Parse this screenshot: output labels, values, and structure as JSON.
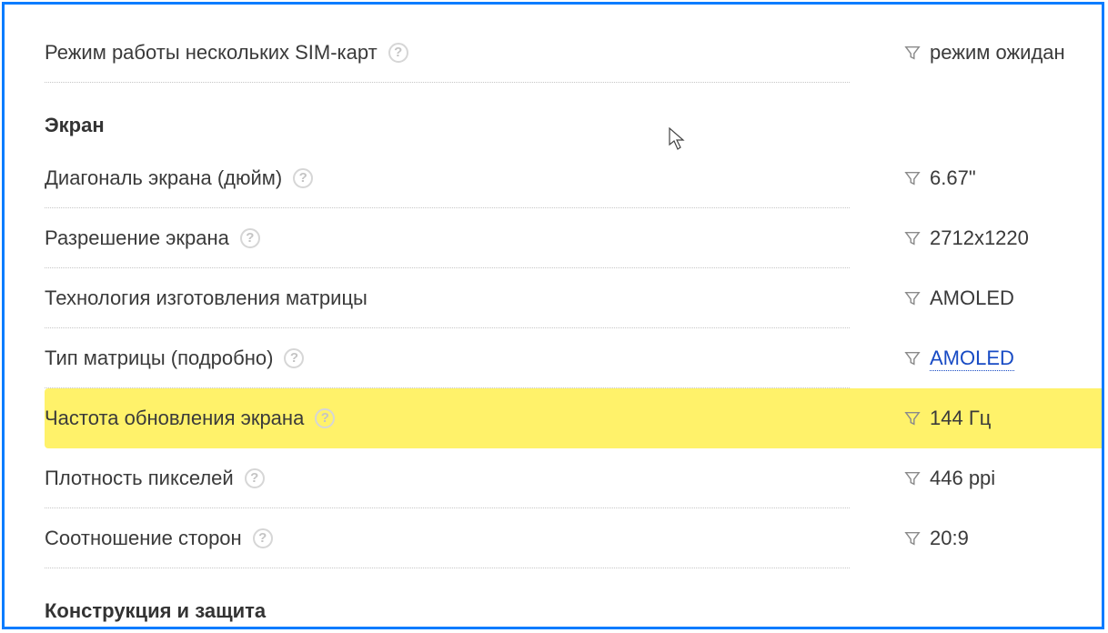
{
  "top_row": {
    "label": "Режим работы нескольких SIM-карт",
    "has_help": true,
    "value": "режим ожидан"
  },
  "section_screen_title": "Экран",
  "screen_rows": [
    {
      "label": "Диагональ экрана (дюйм)",
      "has_help": true,
      "value": "6.67\"",
      "link": false,
      "highlight": false
    },
    {
      "label": "Разрешение экрана",
      "has_help": true,
      "value": "2712x1220",
      "link": false,
      "highlight": false
    },
    {
      "label": "Технология изготовления матрицы",
      "has_help": false,
      "value": "AMOLED",
      "link": false,
      "highlight": false
    },
    {
      "label": "Тип матрицы (подробно)",
      "has_help": true,
      "value": "AMOLED",
      "link": true,
      "highlight": false
    },
    {
      "label": "Частота обновления экрана",
      "has_help": true,
      "value": "144 Гц",
      "link": false,
      "highlight": true
    },
    {
      "label": "Плотность пикселей",
      "has_help": true,
      "value": "446 ppi",
      "link": false,
      "highlight": false
    },
    {
      "label": "Соотношение сторон",
      "has_help": true,
      "value": "20:9",
      "link": false,
      "highlight": false
    }
  ],
  "section_construction_title": "Конструкция и защита",
  "icons": {
    "help_glyph": "?"
  }
}
